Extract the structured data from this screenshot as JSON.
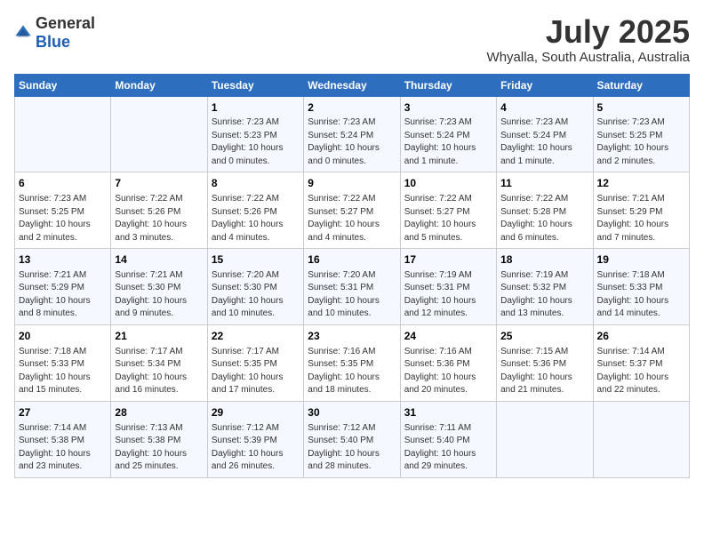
{
  "header": {
    "logo_general": "General",
    "logo_blue": "Blue",
    "month": "July 2025",
    "location": "Whyalla, South Australia, Australia"
  },
  "weekdays": [
    "Sunday",
    "Monday",
    "Tuesday",
    "Wednesday",
    "Thursday",
    "Friday",
    "Saturday"
  ],
  "weeks": [
    [
      {
        "day": "",
        "info": ""
      },
      {
        "day": "",
        "info": ""
      },
      {
        "day": "1",
        "info": "Sunrise: 7:23 AM\nSunset: 5:23 PM\nDaylight: 10 hours and 0 minutes."
      },
      {
        "day": "2",
        "info": "Sunrise: 7:23 AM\nSunset: 5:24 PM\nDaylight: 10 hours and 0 minutes."
      },
      {
        "day": "3",
        "info": "Sunrise: 7:23 AM\nSunset: 5:24 PM\nDaylight: 10 hours and 1 minute."
      },
      {
        "day": "4",
        "info": "Sunrise: 7:23 AM\nSunset: 5:24 PM\nDaylight: 10 hours and 1 minute."
      },
      {
        "day": "5",
        "info": "Sunrise: 7:23 AM\nSunset: 5:25 PM\nDaylight: 10 hours and 2 minutes."
      }
    ],
    [
      {
        "day": "6",
        "info": "Sunrise: 7:23 AM\nSunset: 5:25 PM\nDaylight: 10 hours and 2 minutes."
      },
      {
        "day": "7",
        "info": "Sunrise: 7:22 AM\nSunset: 5:26 PM\nDaylight: 10 hours and 3 minutes."
      },
      {
        "day": "8",
        "info": "Sunrise: 7:22 AM\nSunset: 5:26 PM\nDaylight: 10 hours and 4 minutes."
      },
      {
        "day": "9",
        "info": "Sunrise: 7:22 AM\nSunset: 5:27 PM\nDaylight: 10 hours and 4 minutes."
      },
      {
        "day": "10",
        "info": "Sunrise: 7:22 AM\nSunset: 5:27 PM\nDaylight: 10 hours and 5 minutes."
      },
      {
        "day": "11",
        "info": "Sunrise: 7:22 AM\nSunset: 5:28 PM\nDaylight: 10 hours and 6 minutes."
      },
      {
        "day": "12",
        "info": "Sunrise: 7:21 AM\nSunset: 5:29 PM\nDaylight: 10 hours and 7 minutes."
      }
    ],
    [
      {
        "day": "13",
        "info": "Sunrise: 7:21 AM\nSunset: 5:29 PM\nDaylight: 10 hours and 8 minutes."
      },
      {
        "day": "14",
        "info": "Sunrise: 7:21 AM\nSunset: 5:30 PM\nDaylight: 10 hours and 9 minutes."
      },
      {
        "day": "15",
        "info": "Sunrise: 7:20 AM\nSunset: 5:30 PM\nDaylight: 10 hours and 10 minutes."
      },
      {
        "day": "16",
        "info": "Sunrise: 7:20 AM\nSunset: 5:31 PM\nDaylight: 10 hours and 10 minutes."
      },
      {
        "day": "17",
        "info": "Sunrise: 7:19 AM\nSunset: 5:31 PM\nDaylight: 10 hours and 12 minutes."
      },
      {
        "day": "18",
        "info": "Sunrise: 7:19 AM\nSunset: 5:32 PM\nDaylight: 10 hours and 13 minutes."
      },
      {
        "day": "19",
        "info": "Sunrise: 7:18 AM\nSunset: 5:33 PM\nDaylight: 10 hours and 14 minutes."
      }
    ],
    [
      {
        "day": "20",
        "info": "Sunrise: 7:18 AM\nSunset: 5:33 PM\nDaylight: 10 hours and 15 minutes."
      },
      {
        "day": "21",
        "info": "Sunrise: 7:17 AM\nSunset: 5:34 PM\nDaylight: 10 hours and 16 minutes."
      },
      {
        "day": "22",
        "info": "Sunrise: 7:17 AM\nSunset: 5:35 PM\nDaylight: 10 hours and 17 minutes."
      },
      {
        "day": "23",
        "info": "Sunrise: 7:16 AM\nSunset: 5:35 PM\nDaylight: 10 hours and 18 minutes."
      },
      {
        "day": "24",
        "info": "Sunrise: 7:16 AM\nSunset: 5:36 PM\nDaylight: 10 hours and 20 minutes."
      },
      {
        "day": "25",
        "info": "Sunrise: 7:15 AM\nSunset: 5:36 PM\nDaylight: 10 hours and 21 minutes."
      },
      {
        "day": "26",
        "info": "Sunrise: 7:14 AM\nSunset: 5:37 PM\nDaylight: 10 hours and 22 minutes."
      }
    ],
    [
      {
        "day": "27",
        "info": "Sunrise: 7:14 AM\nSunset: 5:38 PM\nDaylight: 10 hours and 23 minutes."
      },
      {
        "day": "28",
        "info": "Sunrise: 7:13 AM\nSunset: 5:38 PM\nDaylight: 10 hours and 25 minutes."
      },
      {
        "day": "29",
        "info": "Sunrise: 7:12 AM\nSunset: 5:39 PM\nDaylight: 10 hours and 26 minutes."
      },
      {
        "day": "30",
        "info": "Sunrise: 7:12 AM\nSunset: 5:40 PM\nDaylight: 10 hours and 28 minutes."
      },
      {
        "day": "31",
        "info": "Sunrise: 7:11 AM\nSunset: 5:40 PM\nDaylight: 10 hours and 29 minutes."
      },
      {
        "day": "",
        "info": ""
      },
      {
        "day": "",
        "info": ""
      }
    ]
  ]
}
